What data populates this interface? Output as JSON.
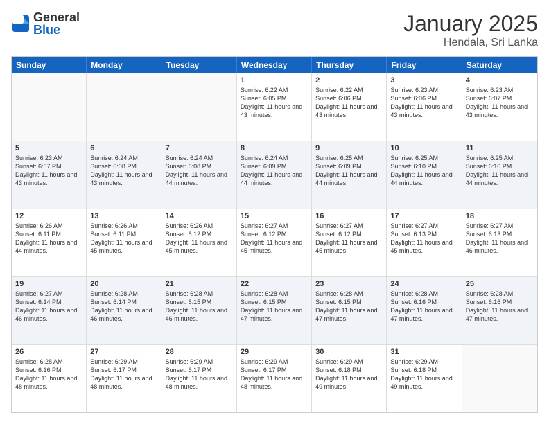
{
  "header": {
    "logo_general": "General",
    "logo_blue": "Blue",
    "month_title": "January 2025",
    "location": "Hendala, Sri Lanka"
  },
  "weekdays": [
    "Sunday",
    "Monday",
    "Tuesday",
    "Wednesday",
    "Thursday",
    "Friday",
    "Saturday"
  ],
  "rows": [
    [
      {
        "day": "",
        "sunrise": "",
        "sunset": "",
        "daylight": ""
      },
      {
        "day": "",
        "sunrise": "",
        "sunset": "",
        "daylight": ""
      },
      {
        "day": "",
        "sunrise": "",
        "sunset": "",
        "daylight": ""
      },
      {
        "day": "1",
        "sunrise": "Sunrise: 6:22 AM",
        "sunset": "Sunset: 6:05 PM",
        "daylight": "Daylight: 11 hours and 43 minutes."
      },
      {
        "day": "2",
        "sunrise": "Sunrise: 6:22 AM",
        "sunset": "Sunset: 6:06 PM",
        "daylight": "Daylight: 11 hours and 43 minutes."
      },
      {
        "day": "3",
        "sunrise": "Sunrise: 6:23 AM",
        "sunset": "Sunset: 6:06 PM",
        "daylight": "Daylight: 11 hours and 43 minutes."
      },
      {
        "day": "4",
        "sunrise": "Sunrise: 6:23 AM",
        "sunset": "Sunset: 6:07 PM",
        "daylight": "Daylight: 11 hours and 43 minutes."
      }
    ],
    [
      {
        "day": "5",
        "sunrise": "Sunrise: 6:23 AM",
        "sunset": "Sunset: 6:07 PM",
        "daylight": "Daylight: 11 hours and 43 minutes."
      },
      {
        "day": "6",
        "sunrise": "Sunrise: 6:24 AM",
        "sunset": "Sunset: 6:08 PM",
        "daylight": "Daylight: 11 hours and 43 minutes."
      },
      {
        "day": "7",
        "sunrise": "Sunrise: 6:24 AM",
        "sunset": "Sunset: 6:08 PM",
        "daylight": "Daylight: 11 hours and 44 minutes."
      },
      {
        "day": "8",
        "sunrise": "Sunrise: 6:24 AM",
        "sunset": "Sunset: 6:09 PM",
        "daylight": "Daylight: 11 hours and 44 minutes."
      },
      {
        "day": "9",
        "sunrise": "Sunrise: 6:25 AM",
        "sunset": "Sunset: 6:09 PM",
        "daylight": "Daylight: 11 hours and 44 minutes."
      },
      {
        "day": "10",
        "sunrise": "Sunrise: 6:25 AM",
        "sunset": "Sunset: 6:10 PM",
        "daylight": "Daylight: 11 hours and 44 minutes."
      },
      {
        "day": "11",
        "sunrise": "Sunrise: 6:25 AM",
        "sunset": "Sunset: 6:10 PM",
        "daylight": "Daylight: 11 hours and 44 minutes."
      }
    ],
    [
      {
        "day": "12",
        "sunrise": "Sunrise: 6:26 AM",
        "sunset": "Sunset: 6:11 PM",
        "daylight": "Daylight: 11 hours and 44 minutes."
      },
      {
        "day": "13",
        "sunrise": "Sunrise: 6:26 AM",
        "sunset": "Sunset: 6:11 PM",
        "daylight": "Daylight: 11 hours and 45 minutes."
      },
      {
        "day": "14",
        "sunrise": "Sunrise: 6:26 AM",
        "sunset": "Sunset: 6:12 PM",
        "daylight": "Daylight: 11 hours and 45 minutes."
      },
      {
        "day": "15",
        "sunrise": "Sunrise: 6:27 AM",
        "sunset": "Sunset: 6:12 PM",
        "daylight": "Daylight: 11 hours and 45 minutes."
      },
      {
        "day": "16",
        "sunrise": "Sunrise: 6:27 AM",
        "sunset": "Sunset: 6:12 PM",
        "daylight": "Daylight: 11 hours and 45 minutes."
      },
      {
        "day": "17",
        "sunrise": "Sunrise: 6:27 AM",
        "sunset": "Sunset: 6:13 PM",
        "daylight": "Daylight: 11 hours and 45 minutes."
      },
      {
        "day": "18",
        "sunrise": "Sunrise: 6:27 AM",
        "sunset": "Sunset: 6:13 PM",
        "daylight": "Daylight: 11 hours and 46 minutes."
      }
    ],
    [
      {
        "day": "19",
        "sunrise": "Sunrise: 6:27 AM",
        "sunset": "Sunset: 6:14 PM",
        "daylight": "Daylight: 11 hours and 46 minutes."
      },
      {
        "day": "20",
        "sunrise": "Sunrise: 6:28 AM",
        "sunset": "Sunset: 6:14 PM",
        "daylight": "Daylight: 11 hours and 46 minutes."
      },
      {
        "day": "21",
        "sunrise": "Sunrise: 6:28 AM",
        "sunset": "Sunset: 6:15 PM",
        "daylight": "Daylight: 11 hours and 46 minutes."
      },
      {
        "day": "22",
        "sunrise": "Sunrise: 6:28 AM",
        "sunset": "Sunset: 6:15 PM",
        "daylight": "Daylight: 11 hours and 47 minutes."
      },
      {
        "day": "23",
        "sunrise": "Sunrise: 6:28 AM",
        "sunset": "Sunset: 6:15 PM",
        "daylight": "Daylight: 11 hours and 47 minutes."
      },
      {
        "day": "24",
        "sunrise": "Sunrise: 6:28 AM",
        "sunset": "Sunset: 6:16 PM",
        "daylight": "Daylight: 11 hours and 47 minutes."
      },
      {
        "day": "25",
        "sunrise": "Sunrise: 6:28 AM",
        "sunset": "Sunset: 6:16 PM",
        "daylight": "Daylight: 11 hours and 47 minutes."
      }
    ],
    [
      {
        "day": "26",
        "sunrise": "Sunrise: 6:28 AM",
        "sunset": "Sunset: 6:16 PM",
        "daylight": "Daylight: 11 hours and 48 minutes."
      },
      {
        "day": "27",
        "sunrise": "Sunrise: 6:29 AM",
        "sunset": "Sunset: 6:17 PM",
        "daylight": "Daylight: 11 hours and 48 minutes."
      },
      {
        "day": "28",
        "sunrise": "Sunrise: 6:29 AM",
        "sunset": "Sunset: 6:17 PM",
        "daylight": "Daylight: 11 hours and 48 minutes."
      },
      {
        "day": "29",
        "sunrise": "Sunrise: 6:29 AM",
        "sunset": "Sunset: 6:17 PM",
        "daylight": "Daylight: 11 hours and 48 minutes."
      },
      {
        "day": "30",
        "sunrise": "Sunrise: 6:29 AM",
        "sunset": "Sunset: 6:18 PM",
        "daylight": "Daylight: 11 hours and 49 minutes."
      },
      {
        "day": "31",
        "sunrise": "Sunrise: 6:29 AM",
        "sunset": "Sunset: 6:18 PM",
        "daylight": "Daylight: 11 hours and 49 minutes."
      },
      {
        "day": "",
        "sunrise": "",
        "sunset": "",
        "daylight": ""
      }
    ]
  ]
}
